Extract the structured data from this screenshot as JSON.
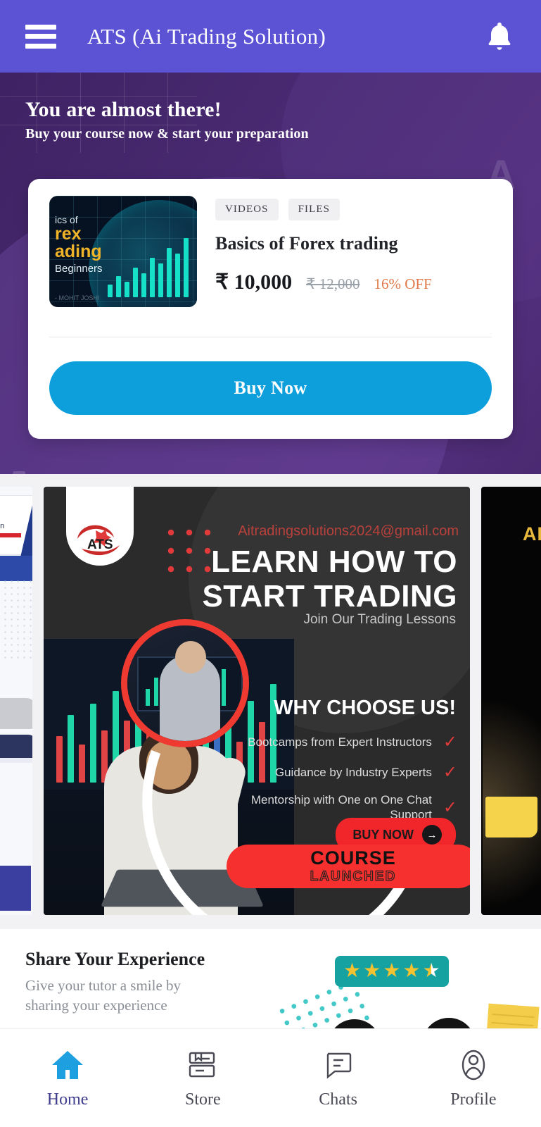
{
  "header": {
    "menu_icon": "hamburger-menu-icon",
    "title": "ATS (Ai Trading Solution)",
    "notification_icon": "bell-icon",
    "bg_color": "#5b52d4"
  },
  "banner": {
    "title": "You are almost there!",
    "subtitle": "Buy your course now & start your preparation",
    "watermark_letter": "A",
    "bg_color": "#4b2b74"
  },
  "course_card": {
    "thumbnail": {
      "line1": "ics of",
      "line2": "rex\nading",
      "line3": "Beginners",
      "credit": "- MOHIT JOSHI"
    },
    "tags": [
      "VIDEOS",
      "FILES"
    ],
    "title": "Basics of Forex trading",
    "price_current": "₹ 10,000",
    "price_original": "₹ 12,000",
    "discount": "16% OFF",
    "buy_label": "Buy Now",
    "buy_color": "#0d9fdc"
  },
  "carousel": {
    "main_slide": {
      "email": "Aitradingsolutions2024@gmail.com",
      "headline_line1": "LEARN HOW TO",
      "headline_line2": "START TRADING",
      "subhead": "Join Our Trading Lessons",
      "why_title": "WHY CHOOSE US!",
      "why_items": [
        "Bootcamps from Expert Instructors",
        "Guidance by Industry Experts",
        "Mentorship with One on One Chat Support"
      ],
      "check_mark": "✓",
      "buy_now_label": "BUY NOW",
      "buy_now_arrow": "→",
      "course_banner_line1": "COURSE",
      "course_banner_line2": "LAUNCHED",
      "logo_name": "ats-bull-logo",
      "accent_red": "#f0262a"
    },
    "next_slide": {
      "ai_text": "AI"
    }
  },
  "review": {
    "title": "Share Your Experience",
    "subtitle": "Give your tutor a smile by sharing your experience",
    "rating_stars": [
      "★",
      "★",
      "★",
      "★",
      "★"
    ],
    "rating_value": 4.5,
    "stars_bg": "#17a2a2"
  },
  "bottom_nav": {
    "items": [
      {
        "label": "Home",
        "icon": "home-icon",
        "active": true
      },
      {
        "label": "Store",
        "icon": "books-icon",
        "active": false
      },
      {
        "label": "Chats",
        "icon": "chat-bubble-icon",
        "active": false
      },
      {
        "label": "Profile",
        "icon": "person-icon",
        "active": false
      }
    ],
    "active_color": "#1e9fe0"
  }
}
